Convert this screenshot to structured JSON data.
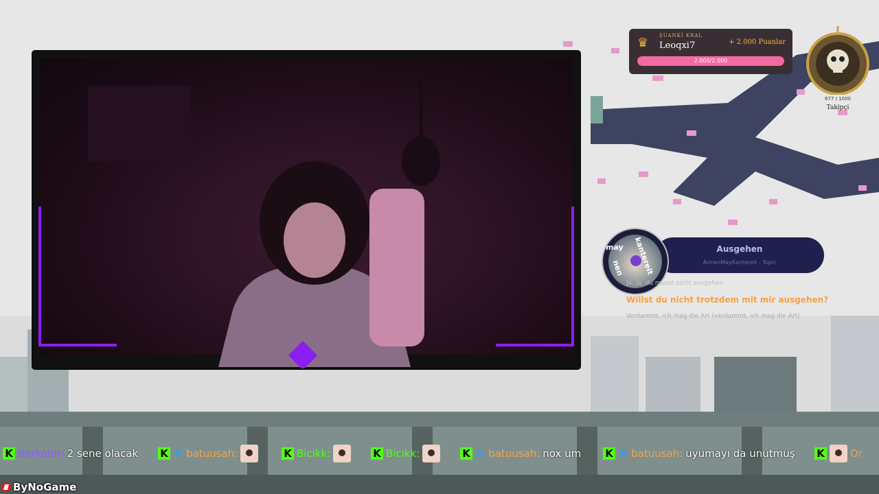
{
  "king": {
    "label": "ŞUANKİ KRAL",
    "name": "Leoqxi7",
    "points": "+ 2.000 Puanlar",
    "progress_text": "2.000/2.000",
    "progress": 1.0
  },
  "followers": {
    "count": "677 / 1000",
    "label": "Takipçi"
  },
  "music": {
    "title": "Ausgehen",
    "artist": "AnnenMayKantereit - Topic",
    "disc_text_1": "kantereit",
    "disc_text_2": "may",
    "disc_text_3": "nen"
  },
  "lyrics": {
    "line1": "Ja, ja, du musst nicht ausgehen",
    "line2": "Willst du nicht trotzdem mit mir ausgehen?",
    "line3": "Verdammt, ich mag die Art (verdammt, ich mag die Art)"
  },
  "chat": [
    {
      "user": "Berkobir:",
      "text": "2 sene olacak",
      "user_color": "purple",
      "verified": false,
      "emote": false
    },
    {
      "user": "batuusah:",
      "text": "",
      "user_color": "orange",
      "verified": true,
      "emote": true
    },
    {
      "user": "Bicikk:",
      "text": "",
      "user_color": "green",
      "verified": false,
      "emote": true
    },
    {
      "user": "Bicikk:",
      "text": "",
      "user_color": "green",
      "verified": false,
      "emote": true
    },
    {
      "user": "batuusah:",
      "text": "nox um",
      "user_color": "orange",
      "verified": true,
      "emote": false
    },
    {
      "user": "batuusah:",
      "text": "uyumayı da unutmuş",
      "user_color": "orange",
      "verified": true,
      "emote": false
    },
    {
      "user": "Or",
      "text": "",
      "user_color": "orange",
      "verified": false,
      "emote": true
    }
  ],
  "brand": {
    "name": "ByNoGame"
  },
  "icons": {
    "kick": "kick-icon",
    "verified": "verified-x-icon",
    "crown": "crown-icon",
    "medal": "skull-medallion-icon",
    "brand": "bynogame-logo-icon"
  }
}
